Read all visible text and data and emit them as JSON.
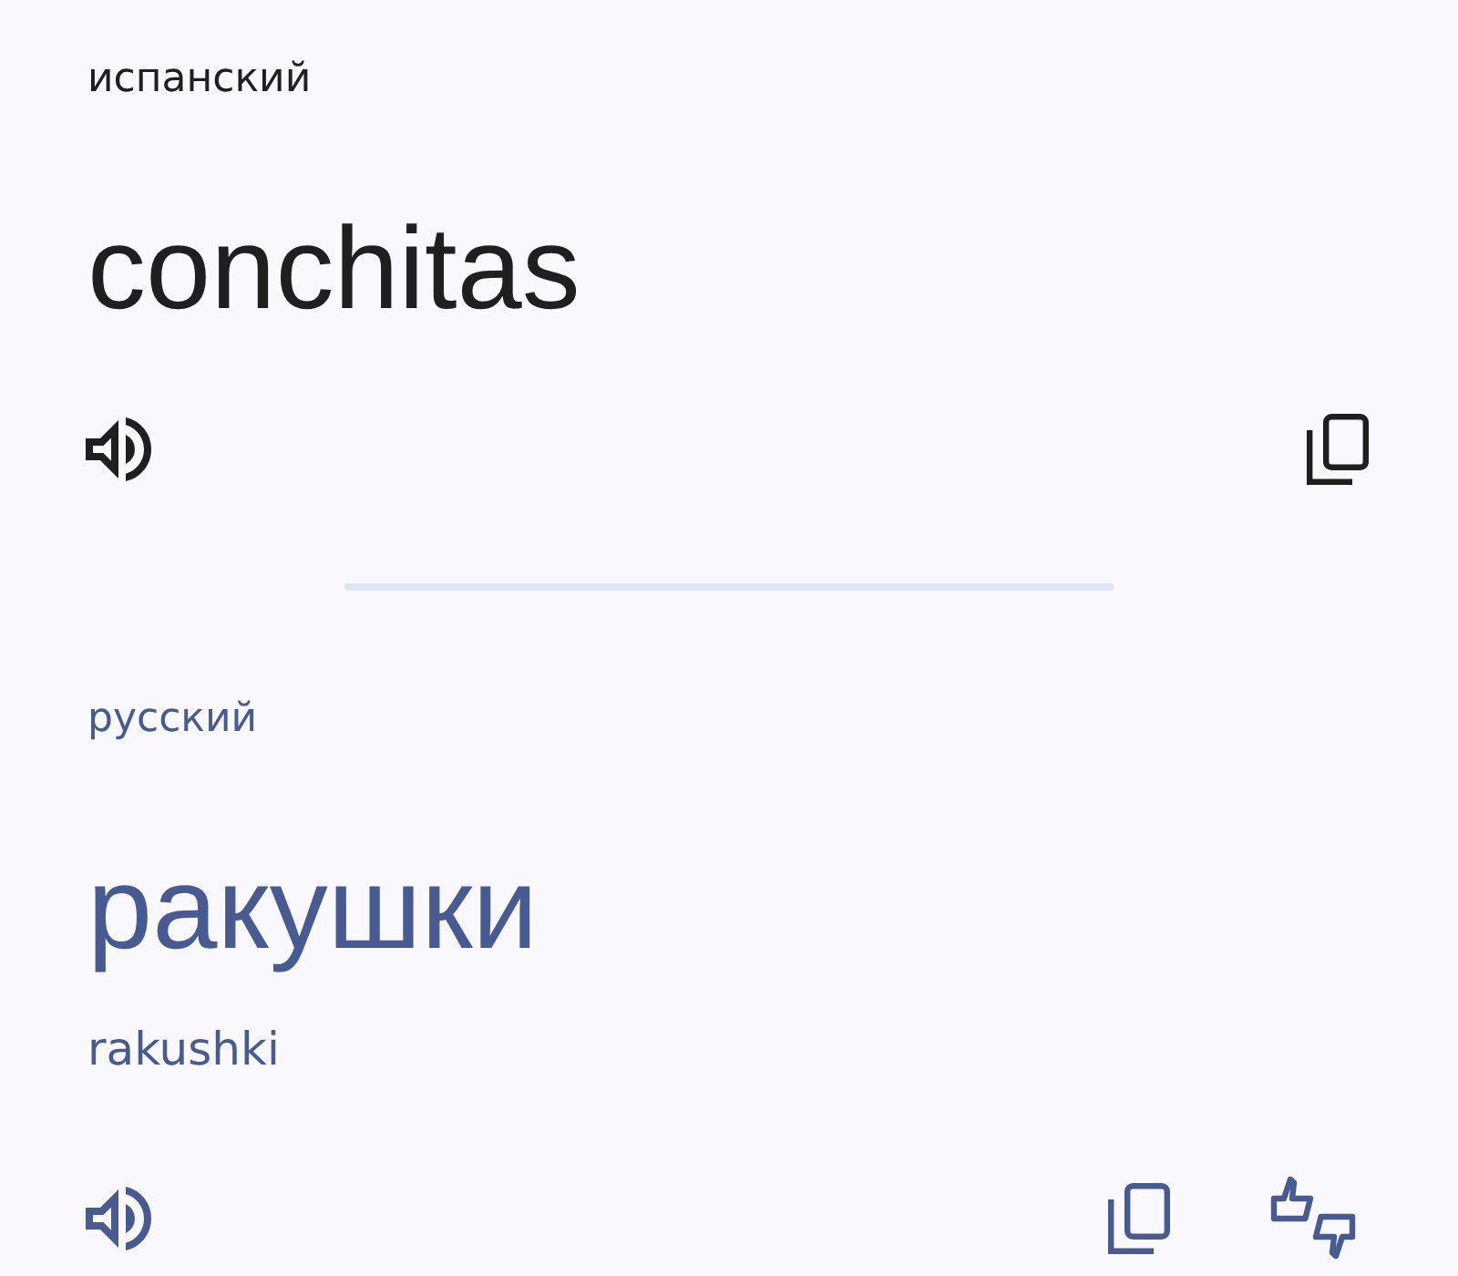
{
  "source": {
    "language": "испанский",
    "text": "conchitas"
  },
  "target": {
    "language": "русский",
    "text": "ракушки",
    "transliteration": "rakushki"
  }
}
